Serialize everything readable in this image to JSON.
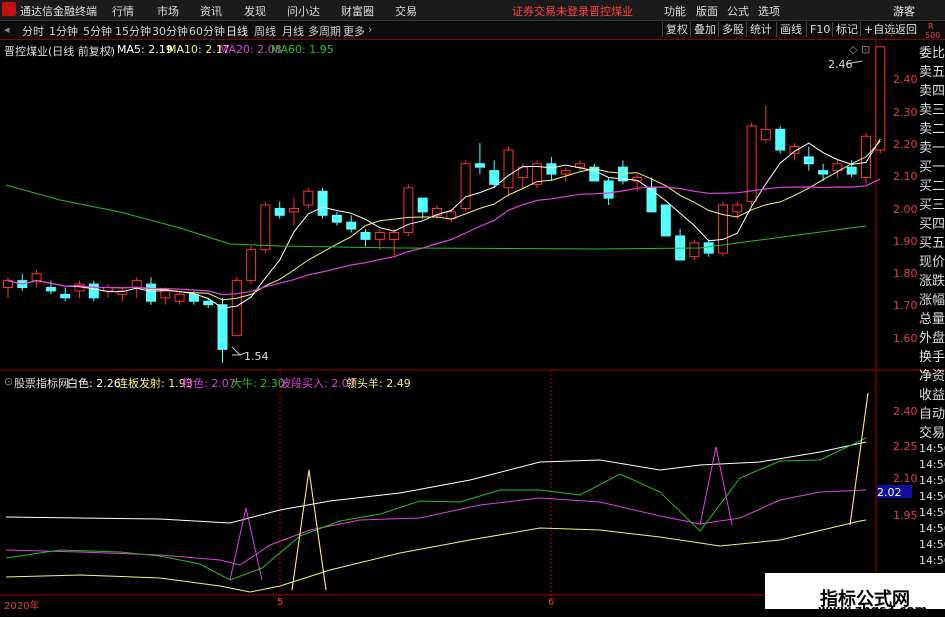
{
  "menubar": {
    "app_title": "通达信金融终端",
    "items": [
      "行情",
      "市场",
      "资讯",
      "发现",
      "问小达",
      "财富圈",
      "交易"
    ],
    "notice": "证券交易未登录",
    "stock_name": "晋控煤业",
    "right_items": [
      "功能",
      "版面",
      "公式",
      "选项"
    ],
    "user": "游客"
  },
  "periods": [
    "分时",
    "1分钟",
    "5分钟",
    "15分钟",
    "30分钟",
    "60分钟",
    "日线",
    "周线",
    "月线",
    "多周期",
    "更多"
  ],
  "right_buttons": [
    "复权",
    "叠加",
    "多股",
    "统计",
    "画线",
    "F10",
    "标记",
    "+自选",
    "返回"
  ],
  "main_chart": {
    "stock_label": "晋控煤业(日线 前复权)",
    "ma": [
      {
        "name": "MA5",
        "value": "2.19",
        "color": "#ffffff"
      },
      {
        "name": "MA10",
        "value": "2.17",
        "color": "#f3f37a"
      },
      {
        "name": "MA20",
        "value": "2.08",
        "color": "#e040e0"
      },
      {
        "name": "MA60",
        "value": "1.95",
        "color": "#22c022"
      }
    ],
    "yticks": [
      "2.40",
      "2.30",
      "2.20",
      "2.10",
      "2.00",
      "1.90",
      "1.80",
      "1.70",
      "1.60"
    ],
    "high_label": "2.46",
    "low_label": "1.54"
  },
  "indicator": {
    "name": "股票指标网",
    "items": [
      {
        "label": "白色",
        "value": "2.26",
        "color": "#ffffff"
      },
      {
        "label": "连板发射",
        "value": "1.93",
        "color": "#f3f37a"
      },
      {
        "label": "粉色",
        "value": "2.07",
        "color": "#e040e0"
      },
      {
        "label": "大牛",
        "value": "2.30",
        "color": "#22c022"
      },
      {
        "label": "波段买入",
        "value": "2.07",
        "color": "#e040e0"
      },
      {
        "label": "领头羊",
        "value": "2.49",
        "color": "#f3f37a"
      }
    ],
    "yticks": [
      "2.40",
      "2.25",
      "2.10",
      "2.02",
      "1.95"
    ]
  },
  "xaxis": [
    "2020年",
    "5",
    "6"
  ],
  "side_panel": {
    "top_labels": [
      "R",
      "500"
    ],
    "items": [
      "委比",
      "卖五",
      "卖四",
      "卖三",
      "卖二",
      "卖一",
      "买一",
      "买二",
      "买三",
      "买四",
      "买五",
      "现价",
      "涨跌",
      "涨幅",
      "总量",
      "外盘",
      "换手",
      "净资",
      "收益",
      "自动",
      "交易"
    ],
    "times": [
      "14:56",
      "14:56",
      "14:56",
      "14:56",
      "14:56",
      "14:56",
      "14:56",
      "14:56"
    ]
  },
  "watermark": {
    "big": "指标公式网",
    "small": "www.zbgs3.com"
  },
  "chart_data": {
    "type": "candlestick",
    "ylim": [
      1.52,
      2.48
    ],
    "candles": [
      [
        1.76,
        1.79,
        1.73,
        1.78
      ],
      [
        1.78,
        1.8,
        1.75,
        1.76
      ],
      [
        1.78,
        1.81,
        1.76,
        1.8
      ],
      [
        1.76,
        1.78,
        1.74,
        1.75
      ],
      [
        1.74,
        1.76,
        1.72,
        1.73
      ],
      [
        1.75,
        1.78,
        1.73,
        1.77
      ],
      [
        1.77,
        1.78,
        1.72,
        1.73
      ],
      [
        1.75,
        1.77,
        1.73,
        1.76
      ],
      [
        1.74,
        1.76,
        1.72,
        1.75
      ],
      [
        1.76,
        1.79,
        1.73,
        1.78
      ],
      [
        1.77,
        1.79,
        1.71,
        1.72
      ],
      [
        1.73,
        1.76,
        1.71,
        1.75
      ],
      [
        1.72,
        1.75,
        1.71,
        1.74
      ],
      [
        1.74,
        1.75,
        1.71,
        1.72
      ],
      [
        1.72,
        1.73,
        1.7,
        1.71
      ],
      [
        1.71,
        1.73,
        1.54,
        1.58
      ],
      [
        1.62,
        1.79,
        1.62,
        1.78
      ],
      [
        1.78,
        1.88,
        1.77,
        1.87
      ],
      [
        1.87,
        2.01,
        1.86,
        2.0
      ],
      [
        1.99,
        2.01,
        1.96,
        1.97
      ],
      [
        1.98,
        2.02,
        1.94,
        1.99
      ],
      [
        2.0,
        2.05,
        1.99,
        2.04
      ],
      [
        2.04,
        2.05,
        1.96,
        1.97
      ],
      [
        1.97,
        1.98,
        1.94,
        1.95
      ],
      [
        1.95,
        1.97,
        1.92,
        1.93
      ],
      [
        1.92,
        1.93,
        1.88,
        1.9
      ],
      [
        1.9,
        1.93,
        1.87,
        1.92
      ],
      [
        1.9,
        1.93,
        1.85,
        1.92
      ],
      [
        1.92,
        2.06,
        1.91,
        2.05
      ],
      [
        2.02,
        2.02,
        1.96,
        1.98
      ],
      [
        1.97,
        2.0,
        1.96,
        1.99
      ],
      [
        1.96,
        1.99,
        1.95,
        1.98
      ],
      [
        1.99,
        2.13,
        1.98,
        2.12
      ],
      [
        2.12,
        2.18,
        2.09,
        2.11
      ],
      [
        2.1,
        2.13,
        2.05,
        2.06
      ],
      [
        2.05,
        2.17,
        2.03,
        2.16
      ],
      [
        2.08,
        2.12,
        2.05,
        2.11
      ],
      [
        2.06,
        2.13,
        2.05,
        2.12
      ],
      [
        2.12,
        2.14,
        2.07,
        2.09
      ],
      [
        2.09,
        2.11,
        2.07,
        2.1
      ],
      [
        2.11,
        2.13,
        2.1,
        2.12
      ],
      [
        2.11,
        2.12,
        2.08,
        2.07
      ],
      [
        2.07,
        2.08,
        2.0,
        2.02
      ],
      [
        2.11,
        2.13,
        2.06,
        2.07
      ],
      [
        2.07,
        2.09,
        2.04,
        2.08
      ],
      [
        2.05,
        2.08,
        2.03,
        1.98
      ],
      [
        2.0,
        2.0,
        1.91,
        1.91
      ],
      [
        1.91,
        1.93,
        1.84,
        1.84
      ],
      [
        1.85,
        1.9,
        1.84,
        1.89
      ],
      [
        1.89,
        1.9,
        1.85,
        1.86
      ],
      [
        1.86,
        2.01,
        1.85,
        2.0
      ],
      [
        1.98,
        2.01,
        1.96,
        2.0
      ],
      [
        2.01,
        2.24,
        2.0,
        2.23
      ],
      [
        2.19,
        2.29,
        2.18,
        2.22
      ],
      [
        2.22,
        2.23,
        2.15,
        2.16
      ],
      [
        2.15,
        2.18,
        2.13,
        2.17
      ],
      [
        2.14,
        2.17,
        2.1,
        2.12
      ],
      [
        2.1,
        2.12,
        2.07,
        2.09
      ],
      [
        2.1,
        2.13,
        2.08,
        2.12
      ],
      [
        2.11,
        2.13,
        2.08,
        2.09
      ],
      [
        2.08,
        2.21,
        2.06,
        2.2
      ],
      [
        2.16,
        2.46,
        2.15,
        2.46
      ]
    ]
  }
}
